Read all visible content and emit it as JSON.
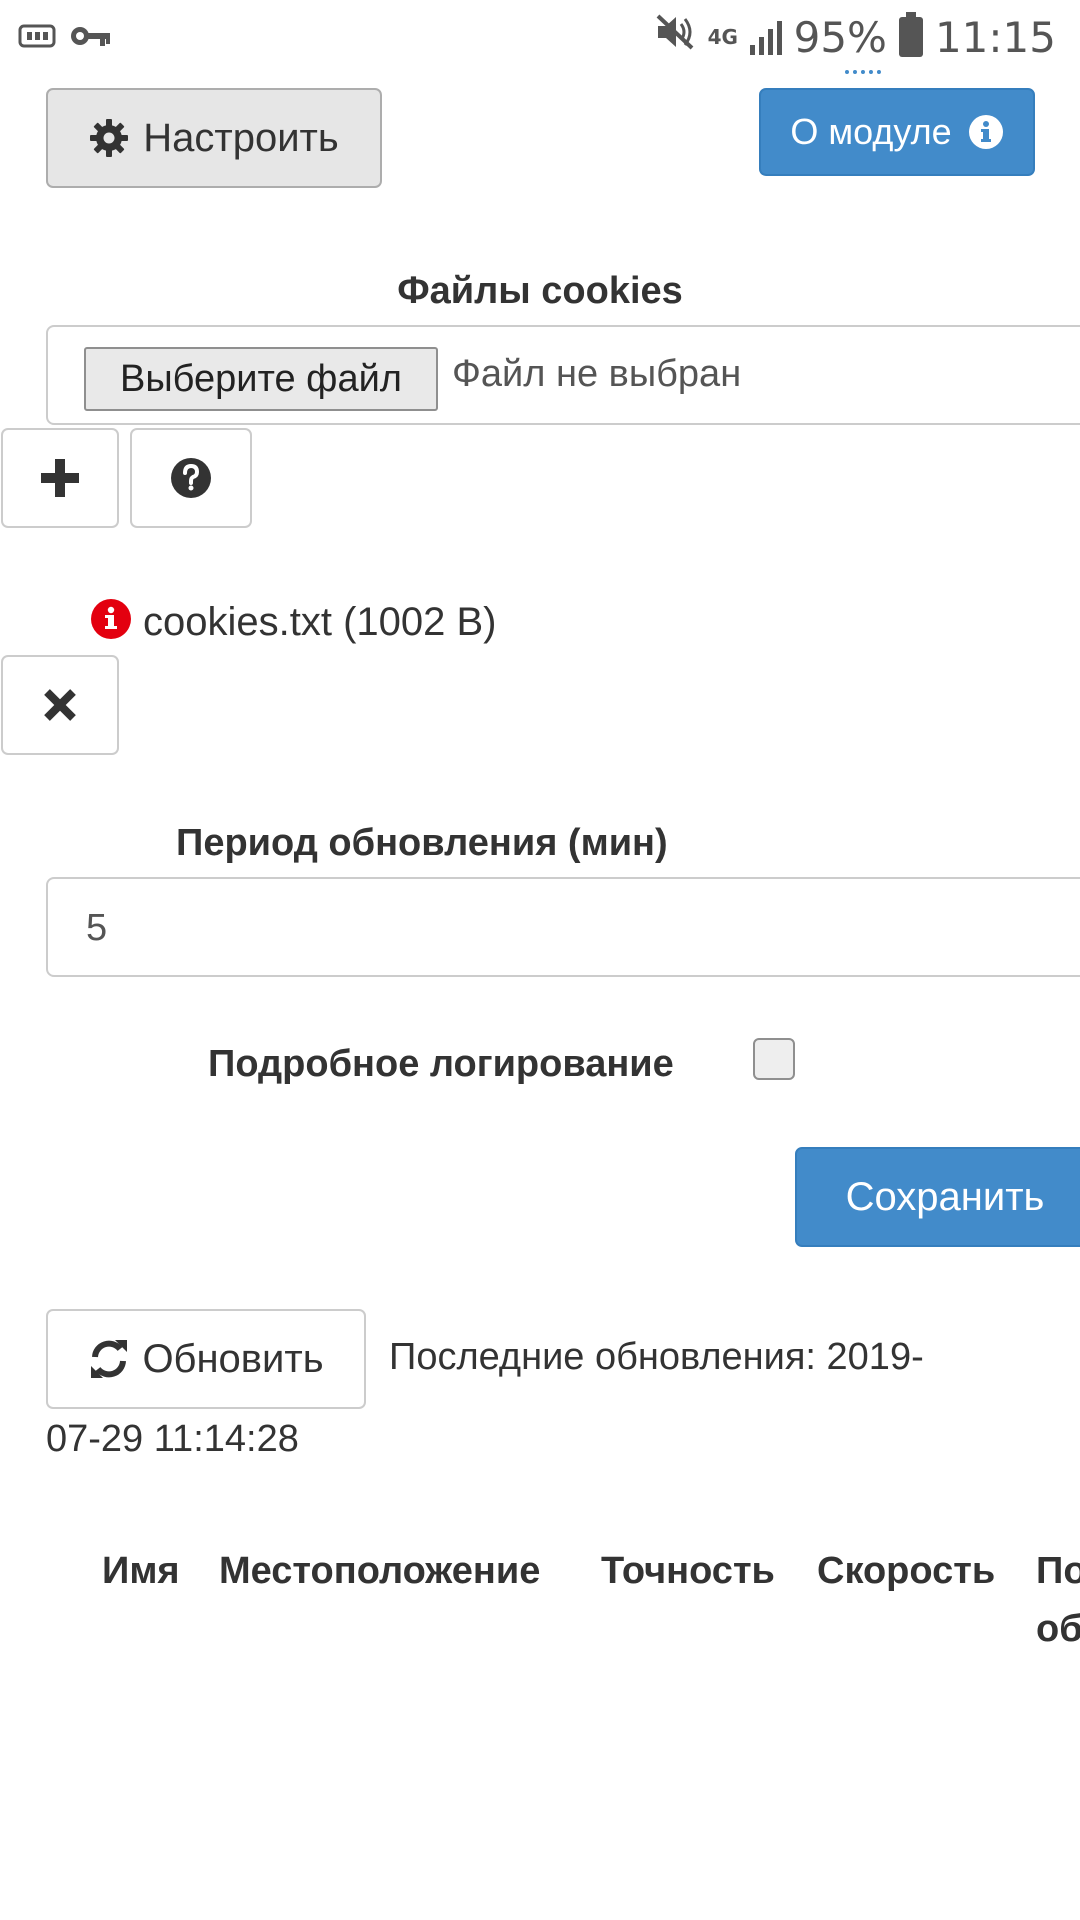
{
  "status_bar": {
    "network": "4G",
    "battery": "95%",
    "time": "11:15"
  },
  "top_buttons": {
    "configure_label": "Настроить",
    "about_label": "О модуле"
  },
  "cookies": {
    "section_label": "Файлы cookies",
    "choose_file_label": "Выберите файл",
    "no_file_text": "Файл не выбран",
    "uploaded_file": "cookies.txt (1002 B)"
  },
  "update_period": {
    "label": "Период обновления (мин)",
    "value": "5"
  },
  "verbose_logging": {
    "label": "Подробное логирование",
    "checked": false
  },
  "save_label": "Сохранить",
  "refresh": {
    "button_label": "Обновить",
    "last_update_line1": "Последние обновления: 2019-",
    "last_update_line2": "07-29 11:14:28"
  },
  "table": {
    "columns": [
      "Имя",
      "Местоположение",
      "Точность",
      "Скорость",
      "По",
      "об"
    ]
  }
}
